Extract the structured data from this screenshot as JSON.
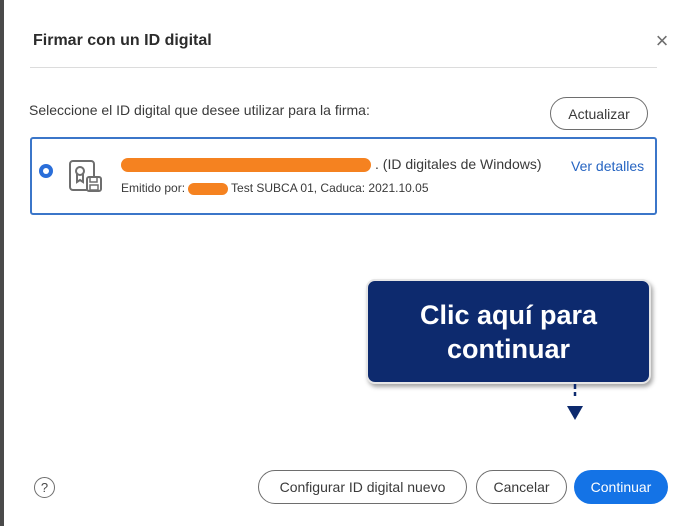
{
  "dialog": {
    "title": "Firmar con un ID digital",
    "close_icon": "×"
  },
  "prompt": "Seleccione el ID digital que desee utilizar para la firma:",
  "refresh_label": "Actualizar",
  "selected_id": {
    "name_suffix": ". (ID digitales de Windows)",
    "details_label": "Ver detalles",
    "issued_prefix": "Emitido por:",
    "issued_rest": "Test SUBCA 01, Caduca: 2021.10.05"
  },
  "callout": {
    "line1": "Clic aquí para",
    "line2": "continuar"
  },
  "footer": {
    "help_icon": "?",
    "configure_label": "Configurar ID digital nuevo",
    "cancel_label": "Cancelar",
    "continue_label": "Continuar"
  },
  "colors": {
    "accent": "#1473e6",
    "card_border": "#3b76c9",
    "link": "#2765c2",
    "redaction": "#f58220",
    "callout_bg": "#0d2a6e"
  }
}
